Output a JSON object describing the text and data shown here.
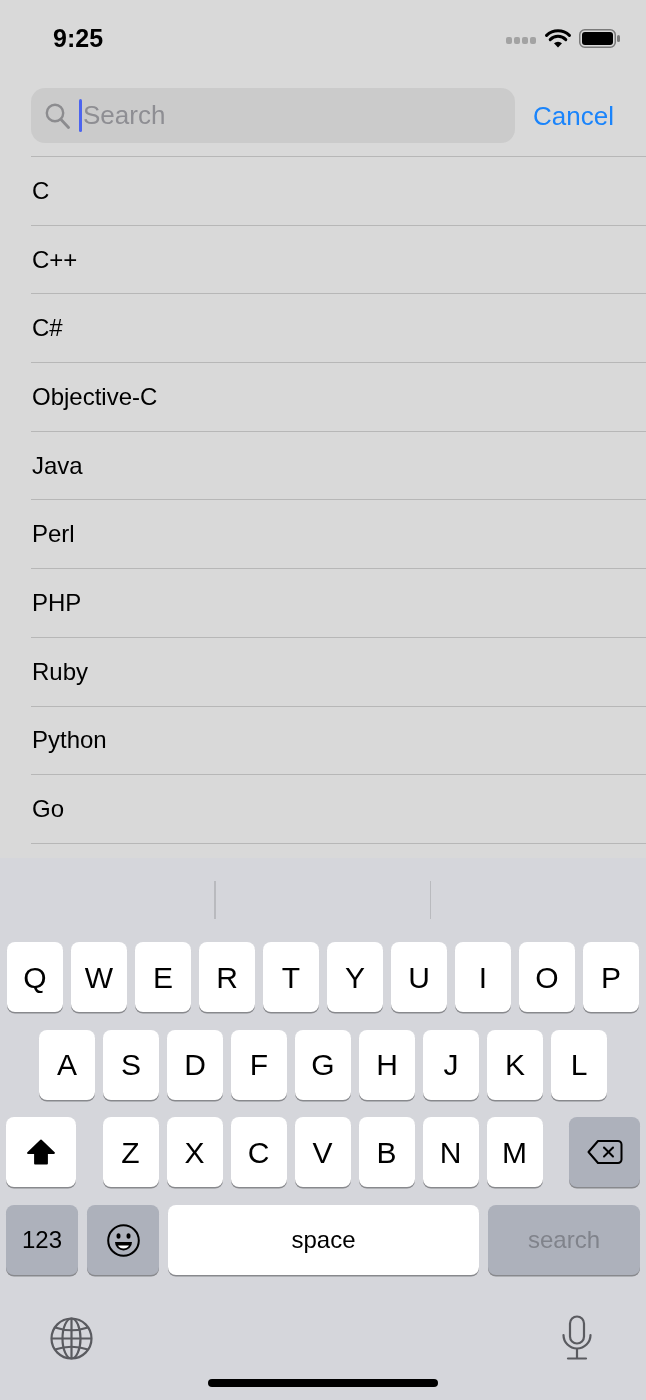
{
  "status_bar": {
    "time": "9:25"
  },
  "search_bar": {
    "placeholder": "Search",
    "focused": true,
    "cancel": "Cancel"
  },
  "results": [
    {
      "label": "C"
    },
    {
      "label": "C++"
    },
    {
      "label": "C#"
    },
    {
      "label": "Objective-C"
    },
    {
      "label": "Java"
    },
    {
      "label": "Perl"
    },
    {
      "label": "PHP"
    },
    {
      "label": "Ruby"
    },
    {
      "label": "Python"
    },
    {
      "label": "Go"
    }
  ],
  "keyboard": {
    "row_1": [
      {
        "kind": "letter",
        "label": "Q"
      },
      {
        "kind": "letter",
        "label": "W"
      },
      {
        "kind": "letter",
        "label": "E"
      },
      {
        "kind": "letter",
        "label": "R"
      },
      {
        "kind": "letter",
        "label": "T"
      },
      {
        "kind": "letter",
        "label": "Y"
      },
      {
        "kind": "letter",
        "label": "U"
      },
      {
        "kind": "letter",
        "label": "I"
      },
      {
        "kind": "letter",
        "label": "O"
      },
      {
        "kind": "letter",
        "label": "P"
      }
    ],
    "row_2": [
      {
        "kind": "letter",
        "label": "A"
      },
      {
        "kind": "letter",
        "label": "S"
      },
      {
        "kind": "letter",
        "label": "D"
      },
      {
        "kind": "letter",
        "label": "F"
      },
      {
        "kind": "letter",
        "label": "G"
      },
      {
        "kind": "letter",
        "label": "H"
      },
      {
        "kind": "letter",
        "label": "J"
      },
      {
        "kind": "letter",
        "label": "K"
      },
      {
        "kind": "letter",
        "label": "L"
      }
    ],
    "row_3": [
      {
        "kind": "shift",
        "on": true
      },
      {
        "kind": "letter",
        "label": "Z"
      },
      {
        "kind": "letter",
        "label": "X"
      },
      {
        "kind": "letter",
        "label": "C"
      },
      {
        "kind": "letter",
        "label": "V"
      },
      {
        "kind": "letter",
        "label": "B"
      },
      {
        "kind": "letter",
        "label": "N"
      },
      {
        "kind": "letter",
        "label": "M"
      },
      {
        "kind": "delete"
      }
    ],
    "row_4": [
      {
        "kind": "mode",
        "label": "123"
      },
      {
        "kind": "emoji"
      },
      {
        "kind": "space",
        "label": "space"
      },
      {
        "kind": "return",
        "label": "search",
        "disabled": true
      }
    ]
  }
}
